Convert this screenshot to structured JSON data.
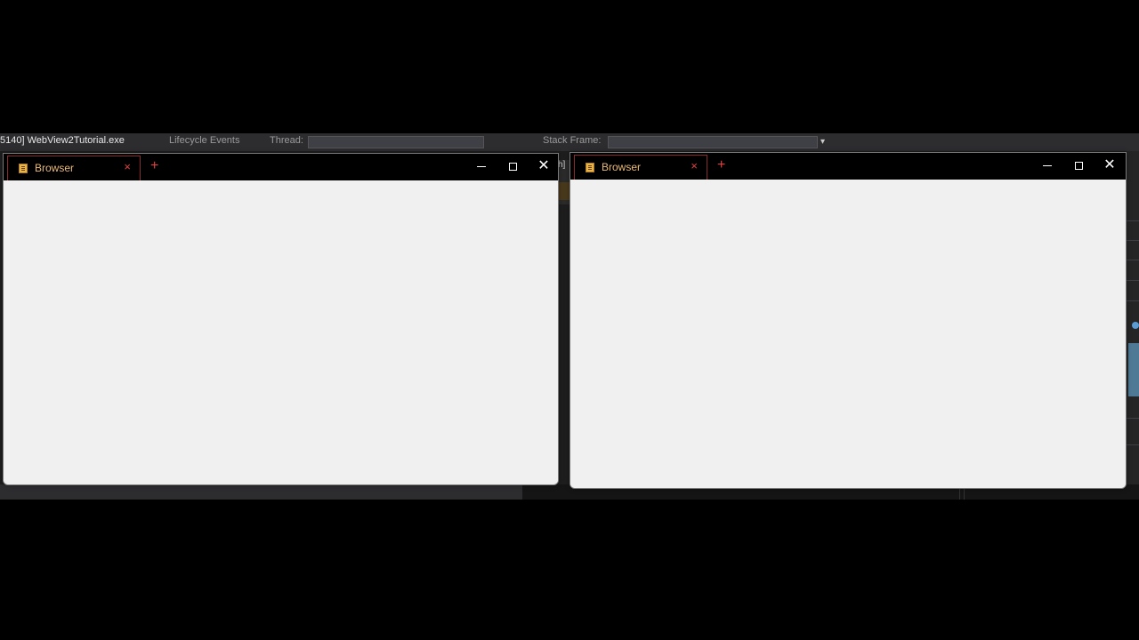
{
  "ide": {
    "process_text": "5140] WebView2Tutorial.exe",
    "lifecycle_label": "Lifecycle Events",
    "thread_label": "Thread:",
    "stack_frame_label": "Stack Frame:",
    "side_fragment": "h]"
  },
  "windows": [
    {
      "tab_title": "Browser",
      "tab_close": "×",
      "new_tab": "+",
      "minimize_label": "Minimize",
      "maximize_label": "Maximize",
      "close_label": "✕"
    },
    {
      "tab_title": "Browser",
      "tab_close": "×",
      "new_tab": "+",
      "minimize_label": "Minimize",
      "maximize_label": "Maximize",
      "close_label": "✕"
    }
  ],
  "colors": {
    "tab_accent": "#e04040",
    "tab_title": "#e8b878",
    "content_bg": "#f0f0f0",
    "titlebar_bg": "#000000"
  }
}
